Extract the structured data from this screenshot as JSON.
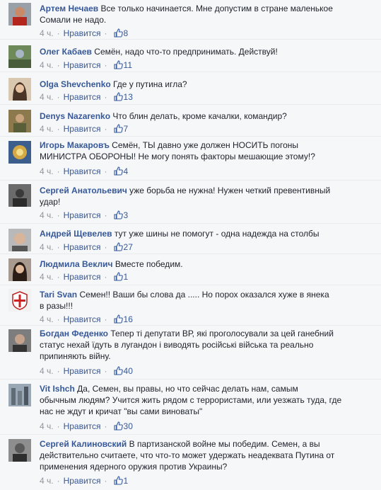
{
  "colors": {
    "link": "#365899",
    "meta": "#90949c",
    "text": "#1d2129",
    "background": "#f6f7f9"
  },
  "comments": [
    {
      "author": "Артем Нечаев",
      "text": "Все только начинается. Мне допустим в стране маленькое",
      "text2": "Сомали не надо.",
      "time": "4 ч.",
      "like_label": "Нравится",
      "likes": "8"
    },
    {
      "author": "Олег Кабаев",
      "text": "Семён, надо что-то предпринимать. Действуй!",
      "time": "4 ч.",
      "like_label": "Нравится",
      "likes": "11"
    },
    {
      "author": "Olga Shevchenko",
      "text": "Где у путина игла?",
      "time": "4 ч.",
      "like_label": "Нравится",
      "likes": "13"
    },
    {
      "author": "Denys Nazarenko",
      "text": "Что блин делать, кроме качалки, командир?",
      "time": "4 ч.",
      "like_label": "Нравится",
      "likes": "7"
    },
    {
      "author": "Игорь Макаровъ",
      "text": "Семён, ТЫ давно уже должен НОСИТЬ погоны",
      "text2": "МИНИСТРА ОБОРОНЫ! Не могу понять факторы мешающие этому!?",
      "time": "4 ч.",
      "like_label": "Нравится",
      "likes": "4"
    },
    {
      "author": "Сергей Анатольевич",
      "text": "уже борьба не нужна! Нужен четкий превентивный",
      "text2": "удар!",
      "time": "4 ч.",
      "like_label": "Нравится",
      "likes": "3"
    },
    {
      "author": "Андрей Щевелев",
      "text": "тут уже шины не помогут - одна надежда на столбы",
      "time": "4 ч.",
      "like_label": "Нравится",
      "likes": "27"
    },
    {
      "author": "Людмила Веклич",
      "text": "Вместе победим.",
      "time": "4 ч.",
      "like_label": "Нравится",
      "likes": "1"
    },
    {
      "author": "Tari Svan",
      "text": "Семен!! Ваши бы слова да ..... Но порох оказался хуже в янека",
      "text2": "в разы!!!",
      "time": "4 ч.",
      "like_label": "Нравится",
      "likes": "16"
    },
    {
      "author": "Богдан Феденко",
      "text": "Тепер ті депутати ВР, які проголосували за цей ганебний",
      "text2": "статус нехай їдуть в лугандон і виводять російські війська та реально",
      "text3": "припиняють війну.",
      "time": "4 ч.",
      "like_label": "Нравится",
      "likes": "40"
    },
    {
      "author": "Vit Ishch",
      "text": "Да, Семен, вы правы, но что сейчас делать нам, самым",
      "text2": "обычным людям? Учится жить рядом с террористами, или уезжать туда, где",
      "text3": "нас не ждут и кричат \"вы сами виноваты\"",
      "time": "4 ч.",
      "like_label": "Нравится",
      "likes": "30"
    },
    {
      "author": "Сергей Калиновский",
      "text": "В партизанской войне мы победим. Семен, а вы",
      "text2": "действительно считаете, что что-то может удержать неадеквата Путина от",
      "text3": "применения ядерного оружия против Украины?",
      "time": "4 ч.",
      "like_label": "Нравится",
      "likes": "1"
    }
  ]
}
